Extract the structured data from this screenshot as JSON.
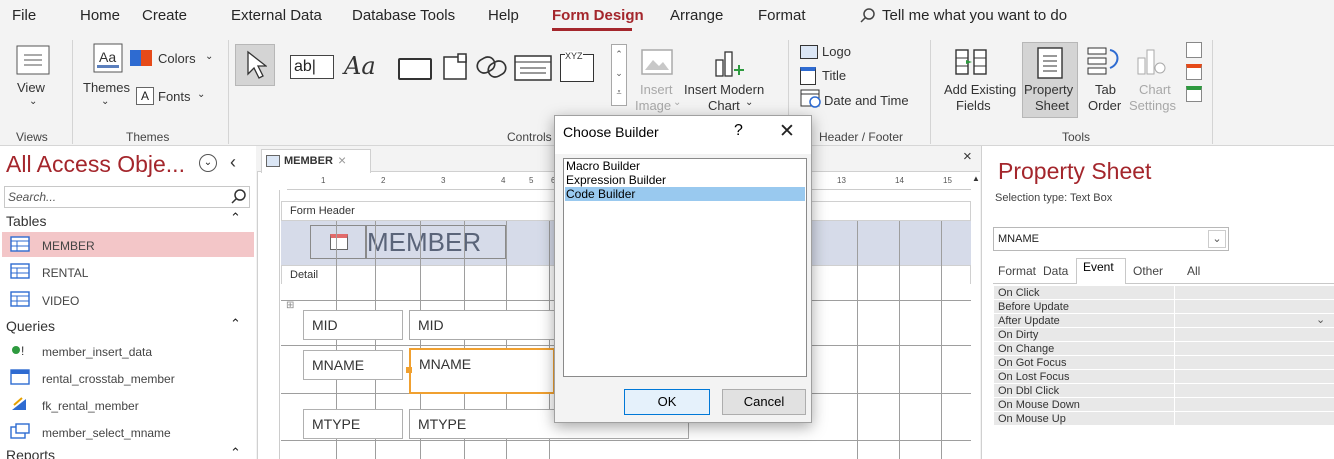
{
  "menu": {
    "items": [
      "File",
      "Home",
      "Create",
      "External Data",
      "Database Tools",
      "Help",
      "Form Design",
      "Arrange",
      "Format"
    ],
    "active": "Form Design",
    "tell_me": "Tell me what you want to do"
  },
  "ribbon": {
    "views": {
      "button": "View",
      "group": "Views"
    },
    "themes": {
      "themes": "Themes",
      "colors": "Colors",
      "fonts": "Fonts",
      "group": "Themes"
    },
    "controls": {
      "textbox_icon": "ab|",
      "label_icon": "Aa",
      "xyz": "XYZ",
      "insert_image": "Insert",
      "insert_image2": "Image",
      "insert_modern": "Insert Modern",
      "chart": "Chart",
      "group": "Controls"
    },
    "header_footer": {
      "logo": "Logo",
      "title": "Title",
      "date_time": "Date and Time",
      "group": "Header / Footer"
    },
    "tools": {
      "add_existing": "Add Existing",
      "fields": "Fields",
      "property": "Property",
      "sheet": "Sheet",
      "tab": "Tab",
      "order": "Order",
      "chart": "Chart",
      "settings": "Settings",
      "group": "Tools"
    }
  },
  "nav": {
    "title": "All Access Obje...",
    "search_placeholder": "Search...",
    "groups": [
      {
        "label": "Tables",
        "items": [
          "MEMBER",
          "RENTAL",
          "VIDEO"
        ]
      },
      {
        "label": "Queries",
        "items": [
          "member_insert_data",
          "rental_crosstab_member",
          "fk_rental_member",
          "member_select_mname"
        ]
      },
      {
        "label": "Reports",
        "items": []
      }
    ]
  },
  "document": {
    "tab_label": "MEMBER",
    "ruler_marks": [
      "1",
      "2",
      "3",
      "4",
      "5",
      "6",
      "13",
      "14",
      "15"
    ],
    "section_header": "Form Header",
    "section_detail": "Detail",
    "form_title": "MEMBER",
    "controls": [
      {
        "label": "MID",
        "field": "MID"
      },
      {
        "label": "MNAME",
        "field": "MNAME"
      },
      {
        "label": "MTYPE",
        "field": "MTYPE"
      }
    ],
    "close_glyph": "×"
  },
  "property_sheet": {
    "title": "Property Sheet",
    "selection_type": "Selection type:  Text Box",
    "selected_control": "MNAME",
    "tabs": [
      "Format",
      "Data",
      "Event",
      "Other",
      "All"
    ],
    "active_tab": "Event",
    "rows": [
      "On Click",
      "Before Update",
      "After Update",
      "On Dirty",
      "On Change",
      "On Got Focus",
      "On Lost Focus",
      "On Dbl Click",
      "On Mouse Down",
      "On Mouse Up"
    ]
  },
  "dialog": {
    "title": "Choose Builder",
    "help": "?",
    "close": "✕",
    "options": [
      "Macro Builder",
      "Expression Builder",
      "Code Builder"
    ],
    "selected": "Code Builder",
    "ok": "OK",
    "cancel": "Cancel"
  },
  "colors": {
    "accent": "#a4262c",
    "selection": "#99c9ef",
    "nav_selected": "#f3c6c8",
    "header_band": "#d6dbe9"
  }
}
